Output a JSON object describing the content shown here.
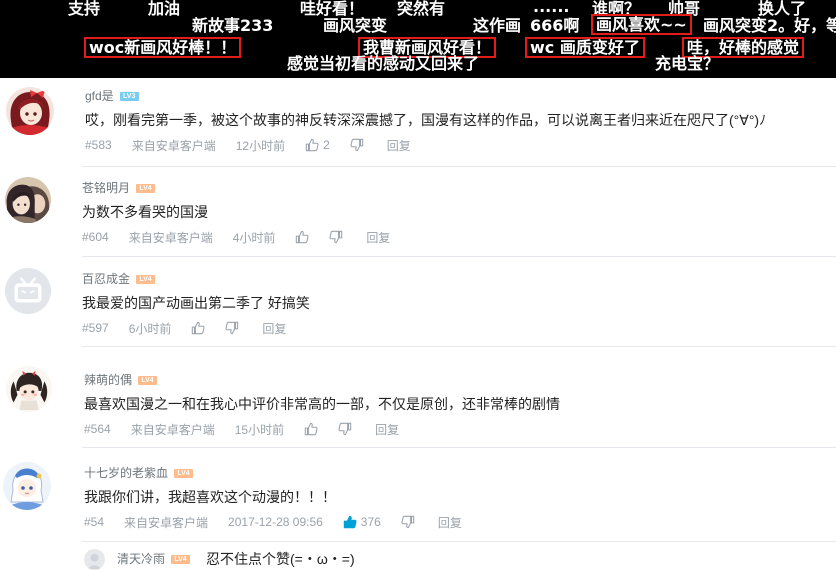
{
  "danmaku": [
    {
      "text": "支持",
      "boxed": false
    },
    {
      "text": "加油",
      "boxed": false
    },
    {
      "text": "哇好看！",
      "boxed": false
    },
    {
      "text": "突然有",
      "boxed": false
    },
    {
      "text": "......",
      "boxed": false
    },
    {
      "text": "谁啊？",
      "boxed": false
    },
    {
      "text": "帅哥",
      "boxed": false
    },
    {
      "text": "换人了",
      "boxed": false
    },
    {
      "text": "新故事233",
      "boxed": false
    },
    {
      "text": "画风突变",
      "boxed": false
    },
    {
      "text": "这作画",
      "boxed": false
    },
    {
      "text": "666啊",
      "boxed": false
    },
    {
      "text": "画风喜欢~~",
      "boxed": true
    },
    {
      "text": "画风突变2。好，等",
      "boxed": false
    },
    {
      "text": "woc新画风好棒！！",
      "boxed": true
    },
    {
      "text": "我曹新画风好看！",
      "boxed": true
    },
    {
      "text": "wc 画质变好了",
      "boxed": true
    },
    {
      "text": "哇，好棒的感觉",
      "boxed": true
    },
    {
      "text": "感觉当初看的感动又回来了",
      "boxed": false
    },
    {
      "text": "充电宝？",
      "boxed": false
    }
  ],
  "comments": [
    {
      "username": "gfd是",
      "level": "LV3",
      "text": "哎，刚看完第一季，被这个故事的神反转深深震撼了，国漫有这样的作品，可以说离王者归来近在咫尺了(°∀°)ﾉ",
      "floor": "#583",
      "device": "来自安卓客户端",
      "time": "12小时前",
      "likes": "2",
      "liked": false,
      "reply_label": "回复"
    },
    {
      "username": "苍铭明月",
      "level": "LV4",
      "text": "为数不多看哭的国漫",
      "floor": "#604",
      "device": "来自安卓客户端",
      "time": "4小时前",
      "liked": false,
      "reply_label": "回复"
    },
    {
      "username": "百忍成金",
      "level": "LV4",
      "text": "我最爱的国产动画出第二季了 好搞笑",
      "floor": "#597",
      "time": "6小时前",
      "liked": false,
      "reply_label": "回复"
    },
    {
      "username": "辣萌的偶",
      "level": "LV4",
      "text": "最喜欢国漫之一和在我心中评价非常高的一部，不仅是原创，还非常棒的剧情",
      "floor": "#564",
      "device": "来自安卓客户端",
      "time": "15小时前",
      "liked": false,
      "reply_label": "回复"
    },
    {
      "username": "十七岁的老紫血",
      "level": "LV4",
      "text": "我跟你们讲，我超喜欢这个动漫的！！！",
      "floor": "#54",
      "device": "来自安卓客户端",
      "time": "2017-12-28 09:56",
      "likes": "376",
      "liked": true,
      "reply_label": "回复"
    }
  ],
  "reply": {
    "username": "清天冷雨",
    "level": "LV4",
    "text": "忍不住点个赞(=・ω・=)"
  },
  "icons": {
    "like": "thumbs-up-icon",
    "dislike": "thumbs-down-icon",
    "default_avatar": "bilibili-tv-icon"
  },
  "colors": {
    "danmaku_box": "#e21b1b",
    "liked": "#00a1d6",
    "levels": {
      "LV3": "#7bcdef",
      "LV4": "#febb8b"
    }
  }
}
